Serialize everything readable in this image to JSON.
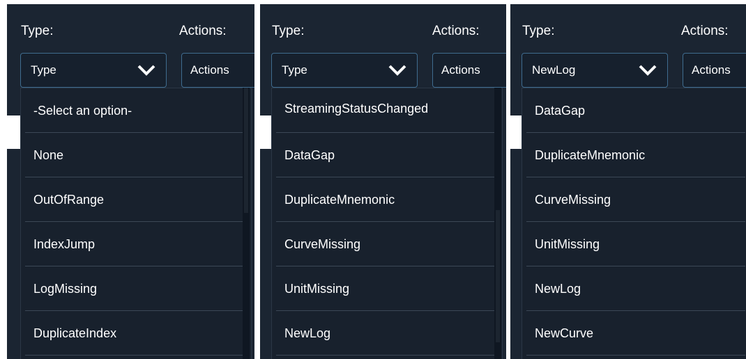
{
  "panels": [
    {
      "type_label": "Type:",
      "actions_label": "Actions:",
      "select_value": "Type",
      "actions_button": "Actions",
      "options": [
        "-Select an option-",
        "None",
        "OutOfRange",
        "IndexJump",
        "LogMissing",
        "DuplicateIndex"
      ]
    },
    {
      "type_label": "Type:",
      "actions_label": "Actions:",
      "select_value": "Type",
      "actions_button": "Actions",
      "options": [
        "StreamingStatusChanged",
        "DataGap",
        "DuplicateMnemonic",
        "CurveMissing",
        "UnitMissing",
        "NewLog"
      ]
    },
    {
      "type_label": "Type:",
      "actions_label": "Actions:",
      "select_value": "NewLog",
      "actions_button": "Actions",
      "options": [
        "DataGap",
        "DuplicateMnemonic",
        "CurveMissing",
        "UnitMissing",
        "NewLog",
        "NewCurve"
      ]
    }
  ],
  "colors": {
    "panel_bg": "#1b2532",
    "border": "#3f6c8f",
    "text": "#ffffff"
  },
  "icons": {
    "select_chevron": "chevron-down-icon"
  }
}
